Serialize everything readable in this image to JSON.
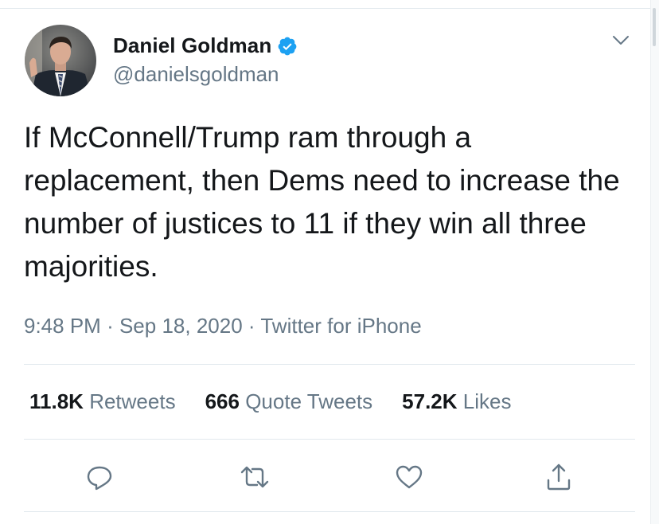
{
  "tweet": {
    "author": {
      "display_name": "Daniel Goldman",
      "handle": "@danielsgoldman",
      "verified": true,
      "verified_color": "#1da1f2"
    },
    "text": "If McConnell/Trump ram through a replacement, then Dems need to increase the number of justices to 11 if they win all three majorities.",
    "time": "9:48 PM",
    "date": "Sep 18, 2020",
    "separator": "·",
    "source": "Twitter for iPhone",
    "stats": {
      "retweets": {
        "count": "11.8K",
        "label": "Retweets"
      },
      "quotes": {
        "count": "666",
        "label": "Quote Tweets"
      },
      "likes": {
        "count": "57.2K",
        "label": "Likes"
      }
    },
    "actions": [
      "reply-icon",
      "retweet-icon",
      "like-icon",
      "share-icon"
    ]
  },
  "colors": {
    "text_primary": "#14171a",
    "text_secondary": "#657786",
    "divider": "#e1e8ed",
    "icon": "#657786"
  }
}
